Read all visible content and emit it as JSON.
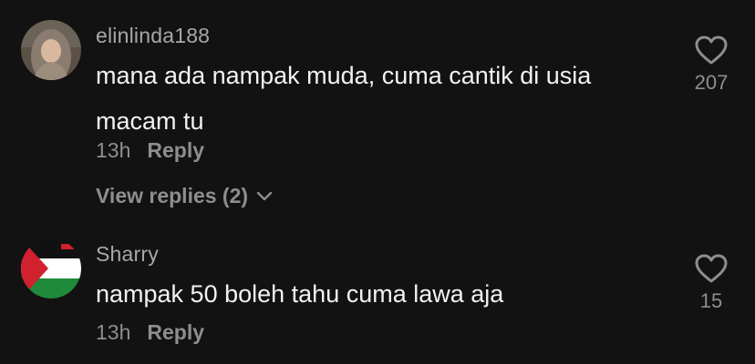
{
  "comments": [
    {
      "username": "elinlinda188",
      "text": "mana ada nampak muda, cuma cantik di usia macam tu",
      "time": "13h",
      "reply_label": "Reply",
      "view_replies_label": "View replies (2)",
      "like_count": "207",
      "avatar_icon": "user-photo-hijab"
    },
    {
      "username": "Sharry",
      "text": "nampak 50 boleh tahu cuma lawa aja",
      "time": "13h",
      "reply_label": "Reply",
      "like_count": "15",
      "avatar_icon": "palestine-flag"
    }
  ],
  "colors": {
    "background": "#121212",
    "username": "#a8a8a8",
    "text": "#f2f2f2",
    "muted": "#8e8e8e"
  }
}
